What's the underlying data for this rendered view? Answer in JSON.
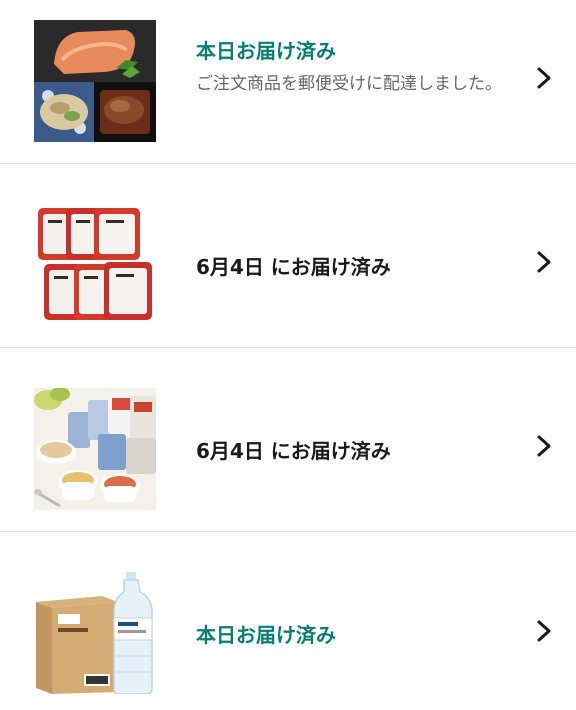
{
  "orders": [
    {
      "status": "本日お届け済み",
      "detail": "ご注文商品を郵便受けに配達しました。",
      "image": "grilled-fish-meal-photo",
      "status_color": "#067d72"
    },
    {
      "status": "6月4日 にお届け済み",
      "image": "packaged-rice-photo",
      "status_color": "#1a1a1a"
    },
    {
      "status": "6月4日 にお届け済み",
      "image": "freeze-dried-soup-photo",
      "status_color": "#1a1a1a"
    },
    {
      "status": "本日お届け済み",
      "image": "water-bottle-box-photo",
      "status_color": "#067d72"
    }
  ],
  "icons": {
    "chevron": "chevron-right-icon"
  }
}
